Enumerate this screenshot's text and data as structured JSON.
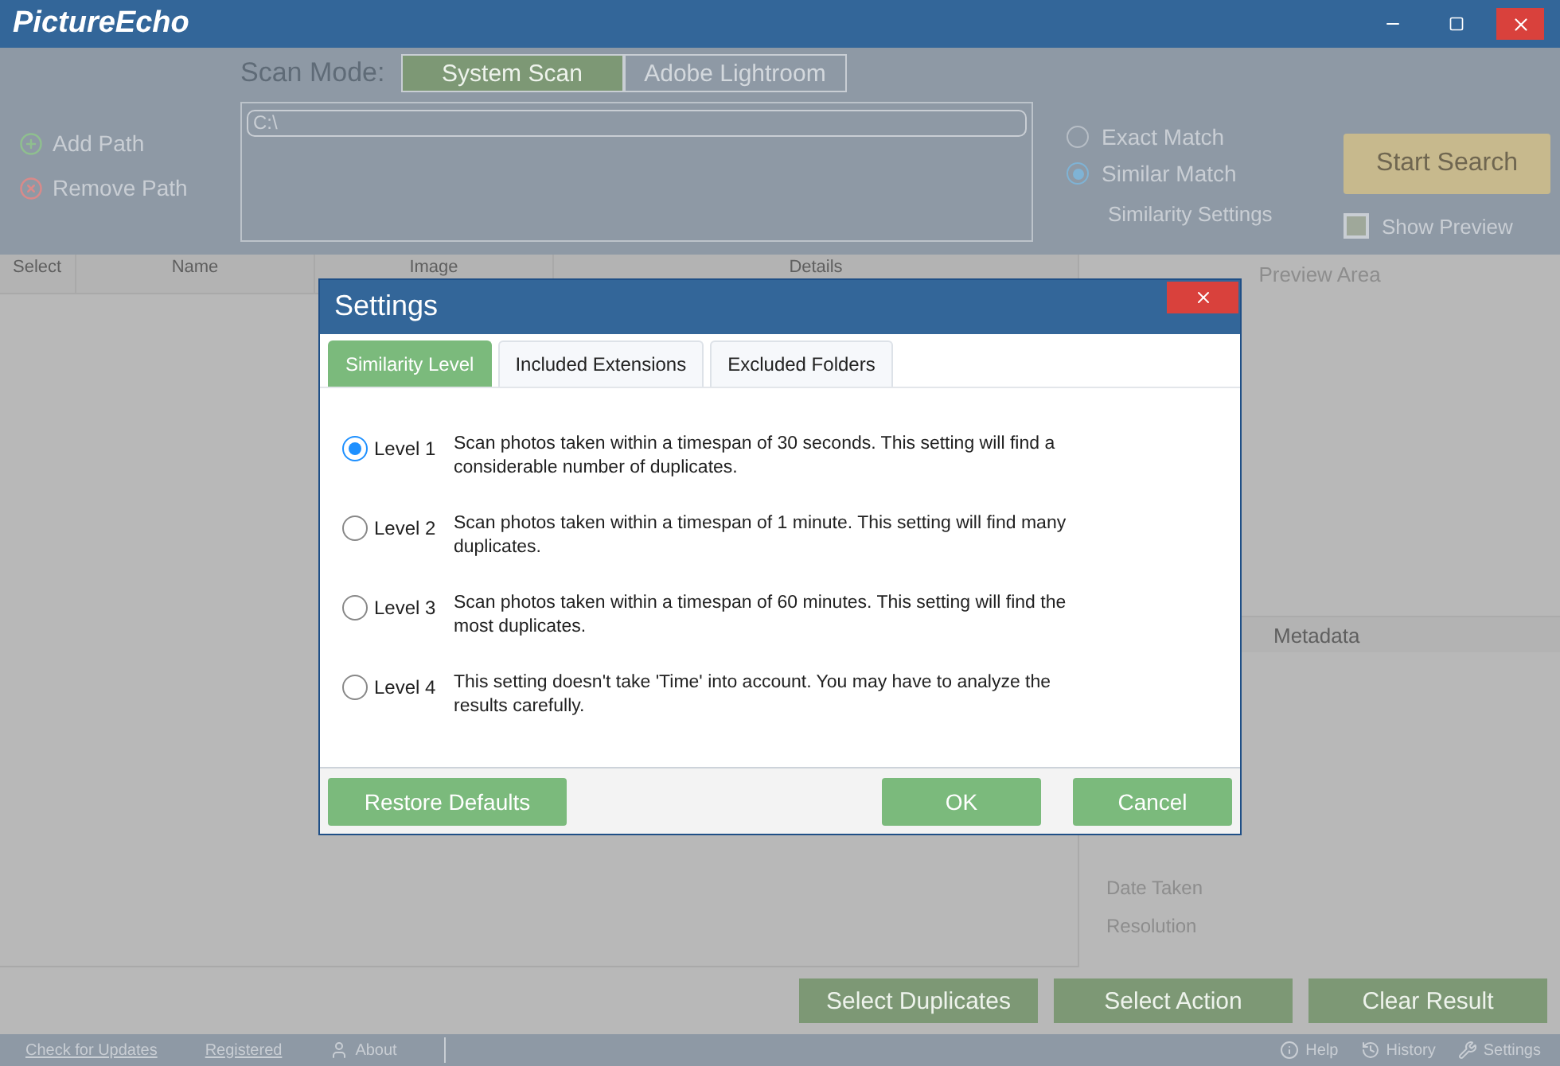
{
  "window": {
    "title": "PictureEcho"
  },
  "scan_mode": {
    "label": "Scan Mode:",
    "options": [
      {
        "label": "System Scan",
        "selected": true
      },
      {
        "label": "Adobe Lightroom",
        "selected": false
      }
    ]
  },
  "path_actions": [
    {
      "label": "Add Path",
      "kind": "add"
    },
    {
      "label": "Remove Path",
      "kind": "remove"
    }
  ],
  "paths": [
    {
      "value": "C:\\"
    }
  ],
  "match_modes": [
    {
      "label": "Exact Match",
      "selected": false
    },
    {
      "label": "Similar Match",
      "selected": true
    }
  ],
  "similarity_settings_link": "Similarity Settings",
  "start_search": "Start Search",
  "show_preview": {
    "label": "Show Preview",
    "checked": false
  },
  "table": {
    "columns": [
      "Select",
      "Name",
      "Image",
      "Details"
    ]
  },
  "preview": {
    "title": "Preview Area",
    "metadata_title": "Metadata",
    "metadata_fields": [
      "Date Taken",
      "Resolution"
    ]
  },
  "actions": [
    "Select Duplicates",
    "Select Action",
    "Clear Result"
  ],
  "status_bar": {
    "left": [
      {
        "label": "Check for Updates",
        "kind": "link"
      },
      {
        "label": "Registered",
        "kind": "link"
      },
      {
        "label": "About",
        "kind": "about"
      }
    ],
    "right": [
      {
        "label": "Help",
        "kind": "help"
      },
      {
        "label": "History",
        "kind": "history"
      },
      {
        "label": "Settings",
        "kind": "settings"
      }
    ]
  },
  "dialog": {
    "title": "Settings",
    "tabs": [
      {
        "label": "Similarity Level",
        "selected": true
      },
      {
        "label": "Included Extensions",
        "selected": false
      },
      {
        "label": "Excluded Folders",
        "selected": false
      }
    ],
    "levels": [
      {
        "label": "Level 1",
        "description": "Scan photos taken within a timespan of 30 seconds. This setting will find a considerable number of duplicates.",
        "selected": true
      },
      {
        "label": "Level 2",
        "description": "Scan photos taken within a timespan of 1 minute. This setting will find many duplicates.",
        "selected": false
      },
      {
        "label": "Level 3",
        "description": "Scan photos taken within a timespan of 60 minutes. This setting will find the most duplicates.",
        "selected": false
      },
      {
        "label": "Level 4",
        "description": "This setting doesn't take 'Time' into account. You may have to analyze the results carefully.",
        "selected": false
      }
    ],
    "buttons": {
      "restore": "Restore Defaults",
      "ok": "OK",
      "cancel": "Cancel"
    }
  }
}
